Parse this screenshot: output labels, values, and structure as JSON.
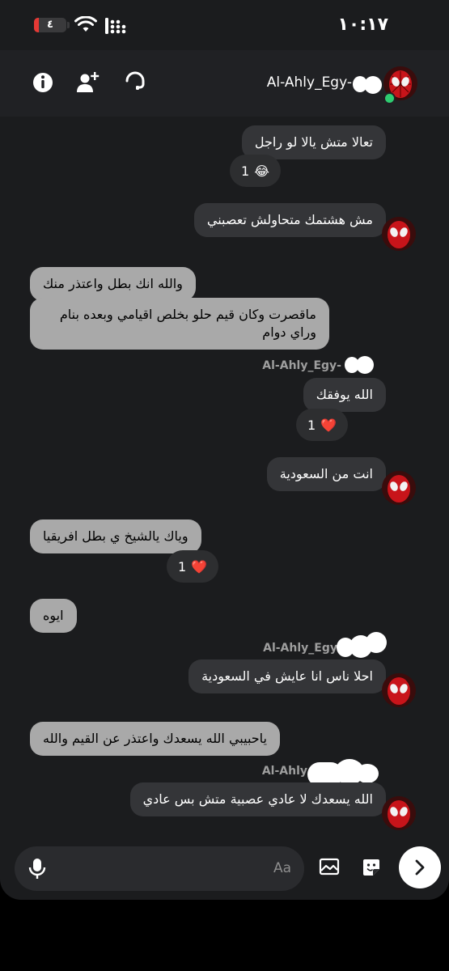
{
  "status_bar": {
    "time": "١٠:١٧",
    "battery_level": "٤",
    "battery_color": "#e53935"
  },
  "header": {
    "contact_name": "Al-Ahly_Egy-",
    "online_color": "#2ecc71"
  },
  "messages": [
    {
      "text": "تعالا متش يالا لو راجل"
    },
    {
      "reaction_emoji": "😂",
      "reaction_count": "1"
    },
    {
      "text": "مش هشتمك متحاولش تعصبني"
    },
    {
      "text": "والله انك بطل واعتذر منك"
    },
    {
      "text": "ماقصرت وكان قيم حلو بخلص اقيامي وبعده بنام وراي دوام"
    },
    {
      "sender": "Al-Ahly_Egy-"
    },
    {
      "text": "الله يوفقك"
    },
    {
      "reaction_emoji": "❤️",
      "reaction_count": "1"
    },
    {
      "text": "انت من السعودية"
    },
    {
      "text": "وياك يالشيخ ي بطل افريقيا"
    },
    {
      "reaction_emoji": "❤️",
      "reaction_count": "1"
    },
    {
      "text": "ايوه"
    },
    {
      "sender": "Al-Ahly_Egy"
    },
    {
      "text": "احلا ناس انا عايش في السعودية"
    },
    {
      "text": "ياحبيبي الله يسعدك واعتذر عن القيم والله"
    },
    {
      "sender": "Al-Ahly"
    },
    {
      "text": "الله يسعدك لا عادي عصبية متش بس عادي"
    }
  ],
  "composer": {
    "placeholder": "Aa"
  }
}
